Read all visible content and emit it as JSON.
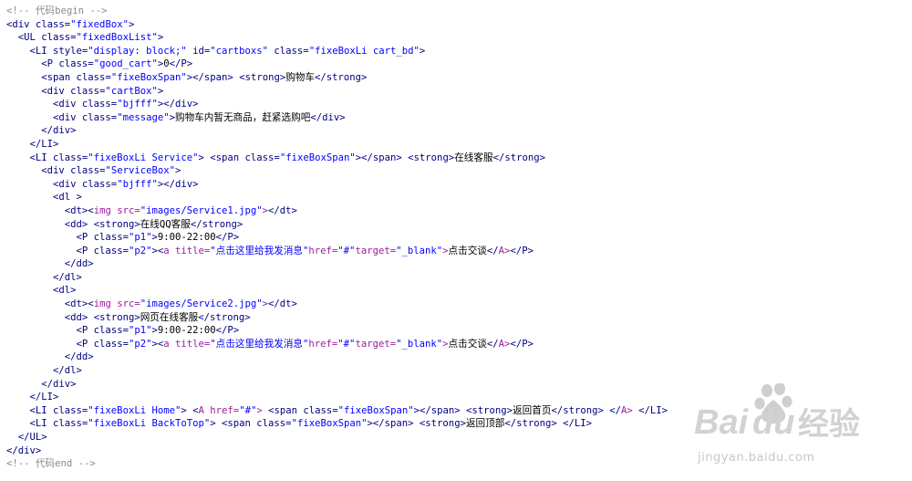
{
  "editor": {
    "lines": [
      "<!-- 代码begin -->",
      "<div class=\"fixedBox\">",
      "  <UL class=\"fixedBoxList\">",
      "    <LI style=\"display: block;\" id=\"cartboxs\" class=\"fixeBoxLi cart_bd\">",
      "      <P class=\"good_cart\">0</P>",
      "      <span class=\"fixeBoxSpan\"></span> <strong>购物车</strong>",
      "      <div class=\"cartBox\">",
      "        <div class=\"bjfff\"></div>",
      "        <div class=\"message\">购物车内暂无商品，赶紧选购吧</div>",
      "      </div>",
      "    </LI>",
      "    <LI class=\"fixeBoxLi Service\"> <span class=\"fixeBoxSpan\"></span> <strong>在线客服</strong>",
      "      <div class=\"ServiceBox\">",
      "        <div class=\"bjfff\"></div>",
      "        <dl >",
      "          <dt><img src=\"images/Service1.jpg\"></dt>",
      "          <dd> <strong>在线QQ客服</strong>",
      "            <P class=\"p1\">9:00-22:00</P>",
      "            <P class=\"p2\"><a title=\"点击这里给我发消息\"href=\"#\"target=\"_blank\">点击交谈</A></P>",
      "          </dd>",
      "        </dl>",
      "        <dl>",
      "          <dt><img src=\"images/Service2.jpg\"></dt>",
      "          <dd> <strong>网页在线客服</strong>",
      "            <P class=\"p1\">9:00-22:00</P>",
      "            <P class=\"p2\"><a title=\"点击这里给我发消息\"href=\"#\"target=\"_blank\">点击交谈</A></P>",
      "          </dd>",
      "        </dl>",
      "      </div>",
      "    </LI>",
      "    <LI class=\"fixeBoxLi Home\"> <A href=\"#\"> <span class=\"fixeBoxSpan\"></span> <strong>返回首页</strong> </A> </LI>",
      "    <LI class=\"fixeBoxLi BackToTop\"> <span class=\"fixeBoxSpan\"></span> <strong>返回顶部</strong> </LI>",
      "  </UL>",
      "</div>",
      "<!-- 代码end -->"
    ]
  },
  "watermark": {
    "brand_left": "Bai",
    "brand_right": "经验",
    "url": "jingyan.baidu.com"
  },
  "colors": {
    "tag": "#000080",
    "string": "#0000ff",
    "html_element": "#9b1e9b",
    "comment": "#8a8a8a",
    "text": "#000000"
  }
}
